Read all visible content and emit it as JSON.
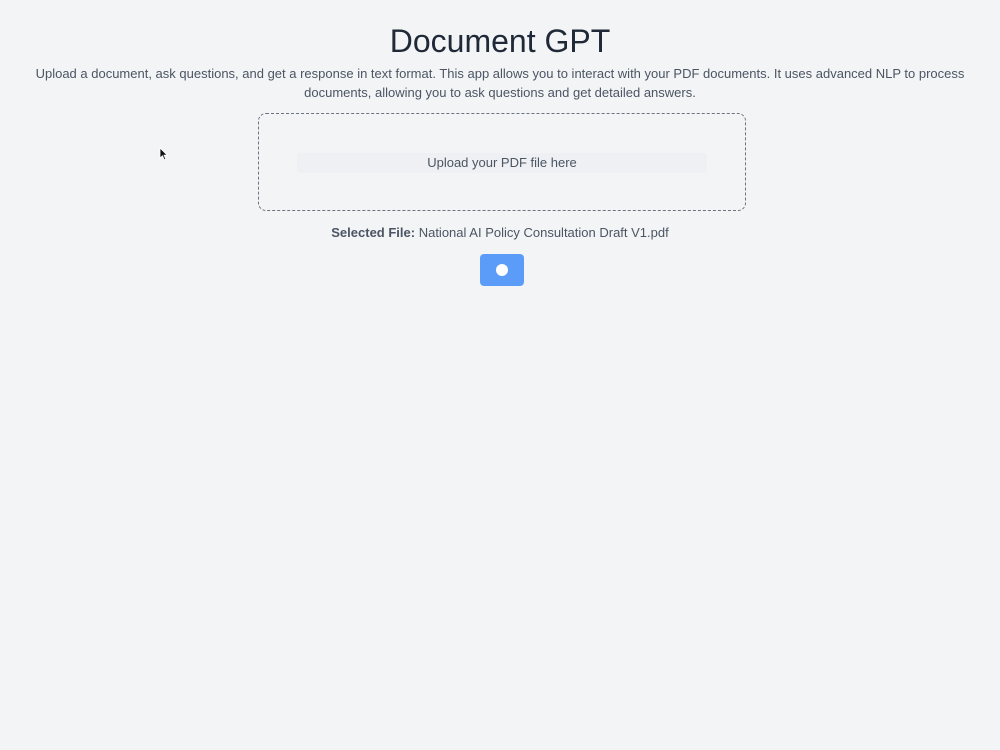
{
  "header": {
    "title": "Document GPT",
    "description": "Upload a document, ask questions, and get a response in text format. This app allows you to interact with your PDF documents. It uses advanced NLP to process documents, allowing you to ask questions and get detailed answers."
  },
  "upload": {
    "prompt": "Upload your PDF file here"
  },
  "selected_file": {
    "label": "Selected File:",
    "name": "National AI Policy Consultation Draft V1.pdf"
  },
  "submit": {
    "icon": "circle-dot-icon",
    "state": "loading"
  },
  "colors": {
    "background": "#f3f4f6",
    "accent": "#5b9cf8",
    "title": "#1f2937",
    "text": "#4b5563"
  },
  "pointer": {
    "icon": "mouse-pointer-icon"
  }
}
